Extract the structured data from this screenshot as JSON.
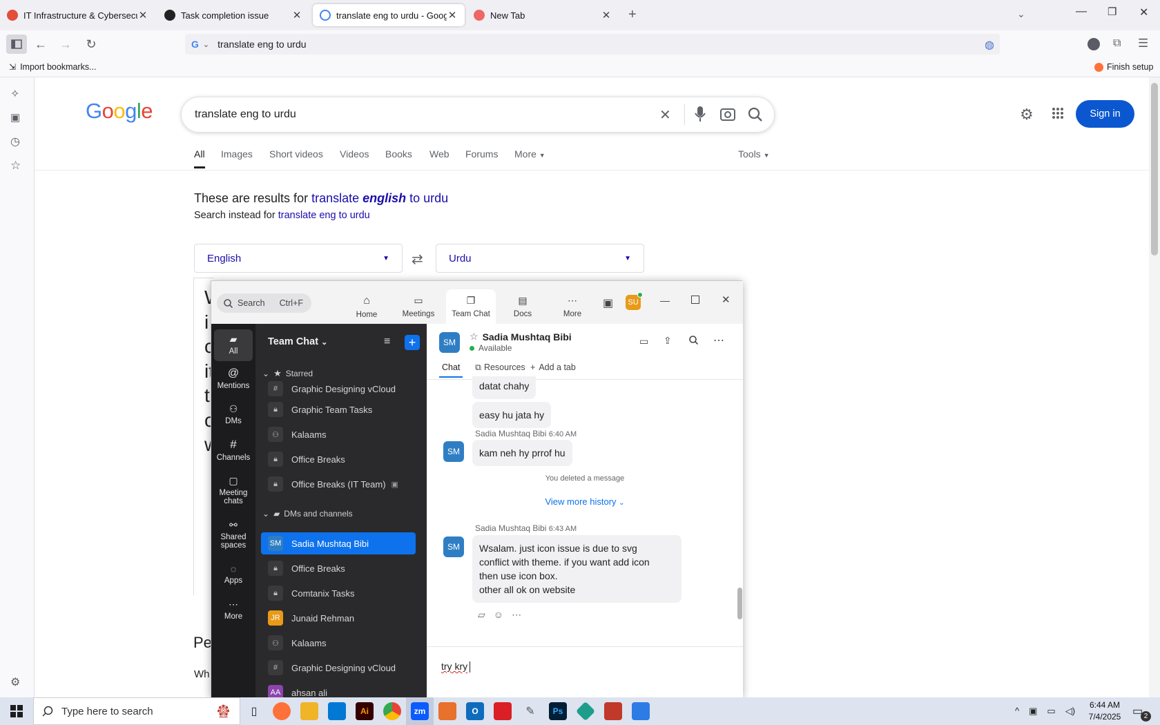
{
  "browser": {
    "tabs": [
      {
        "title": "IT Infrastructure & Cybersecurit",
        "color": "#e44d3a"
      },
      {
        "title": "Task completion issue",
        "color": "#222"
      },
      {
        "title": "translate eng to urdu - Google S",
        "color": "#4285f4"
      },
      {
        "title": "New Tab",
        "color": "#e66"
      }
    ],
    "url": "translate eng to urdu",
    "bookmarks_import": "Import bookmarks...",
    "finish_setup": "Finish setup"
  },
  "google": {
    "logo": "Google",
    "query": "translate eng to urdu",
    "tabs": [
      "All",
      "Images",
      "Short videos",
      "Videos",
      "Books",
      "Web",
      "Forums",
      "More",
      "Tools"
    ],
    "sign_in": "Sign in",
    "results_for_prefix": "These are results for ",
    "results_for_link_a": "translate ",
    "results_for_link_b": "english",
    "results_for_link_c": " to urdu",
    "search_instead_prefix": "Search instead for ",
    "search_instead_link": "translate eng to urdu",
    "source_lang": "English",
    "target_lang": "Urdu",
    "peek_text": [
      "W",
      "i",
      "c",
      "it",
      "t",
      "c",
      "w"
    ],
    "peek_bottom_a": "Pe",
    "peek_bottom_b": "Wh"
  },
  "zoom": {
    "search_label": "Search",
    "search_shortcut": "Ctrl+F",
    "nav": [
      "Home",
      "Meetings",
      "Team Chat",
      "Docs",
      "More"
    ],
    "user_initials": "SU",
    "rail": [
      "All",
      "Mentions",
      "DMs",
      "Channels",
      "Meeting chats",
      "Shared spaces",
      "Apps",
      "More"
    ],
    "list_title": "Team Chat",
    "starred_label": "Starred",
    "starred": [
      "Graphic Designing vCloud",
      "Graphic Team Tasks",
      "Kalaams",
      "Office Breaks",
      "Office Breaks (IT Team)"
    ],
    "dms_label": "DMs and channels",
    "dms": [
      {
        "name": "Sadia Mushtaq Bibi",
        "initials": "SM"
      },
      {
        "name": "Office Breaks",
        "initials": ""
      },
      {
        "name": "Comtanix Tasks",
        "initials": ""
      },
      {
        "name": "Junaid Rehman",
        "initials": "JR"
      },
      {
        "name": "Kalaams",
        "initials": ""
      },
      {
        "name": "Graphic Designing vCloud",
        "initials": "#"
      },
      {
        "name": "ahsan ali",
        "initials": "AA"
      }
    ],
    "contact_name": "Sadia Mushtaq Bibi",
    "contact_initials": "SM",
    "contact_status": "Available",
    "chat_tabs": [
      "Chat",
      "Resources",
      "Add a tab"
    ],
    "msg_partial": "datat chahy",
    "msg_easy": "easy hu jata hy",
    "msg2_sender": "Sadia Mushtaq Bibi",
    "msg2_time": "6:40 AM",
    "msg2_text": "kam neh hy prrof hu",
    "deleted_note": "You deleted a message",
    "view_more": "View more history",
    "msg3_sender": "Sadia Mushtaq Bibi",
    "msg3_time": "6:43 AM",
    "msg3_lines": [
      "Wsalam. just icon issue is due to svg",
      "conflict with theme. if you want add icon",
      "then use icon box.",
      "other all ok on website"
    ],
    "compose_text": "try kry"
  },
  "taskbar": {
    "search_placeholder": "Type here to search",
    "time": "6:44 AM",
    "date": "7/4/2025",
    "notif_count": "2",
    "apps": [
      {
        "name": "firefox",
        "color": "#ff7139",
        "label": ""
      },
      {
        "name": "explorer",
        "color": "#f0b429",
        "label": ""
      },
      {
        "name": "vscode",
        "color": "#0078d4",
        "label": ""
      },
      {
        "name": "illustrator",
        "color": "#330000",
        "label": "Ai"
      },
      {
        "name": "chrome",
        "color": "#34a853",
        "label": ""
      },
      {
        "name": "zoom",
        "color": "#0b5cff",
        "label": "zm"
      },
      {
        "name": "app7",
        "color": "#e8712b",
        "label": ""
      },
      {
        "name": "outlook",
        "color": "#0f6cbd",
        "label": "O"
      },
      {
        "name": "creative-cloud",
        "color": "#da1f26",
        "label": ""
      },
      {
        "name": "tool",
        "color": "#555",
        "label": ""
      },
      {
        "name": "photoshop",
        "color": "#001e36",
        "label": "Ps"
      },
      {
        "name": "app12",
        "color": "#1f9d8b",
        "label": ""
      },
      {
        "name": "app13",
        "color": "#c0392b",
        "label": ""
      },
      {
        "name": "app14",
        "color": "#2d7be5",
        "label": ""
      }
    ]
  }
}
